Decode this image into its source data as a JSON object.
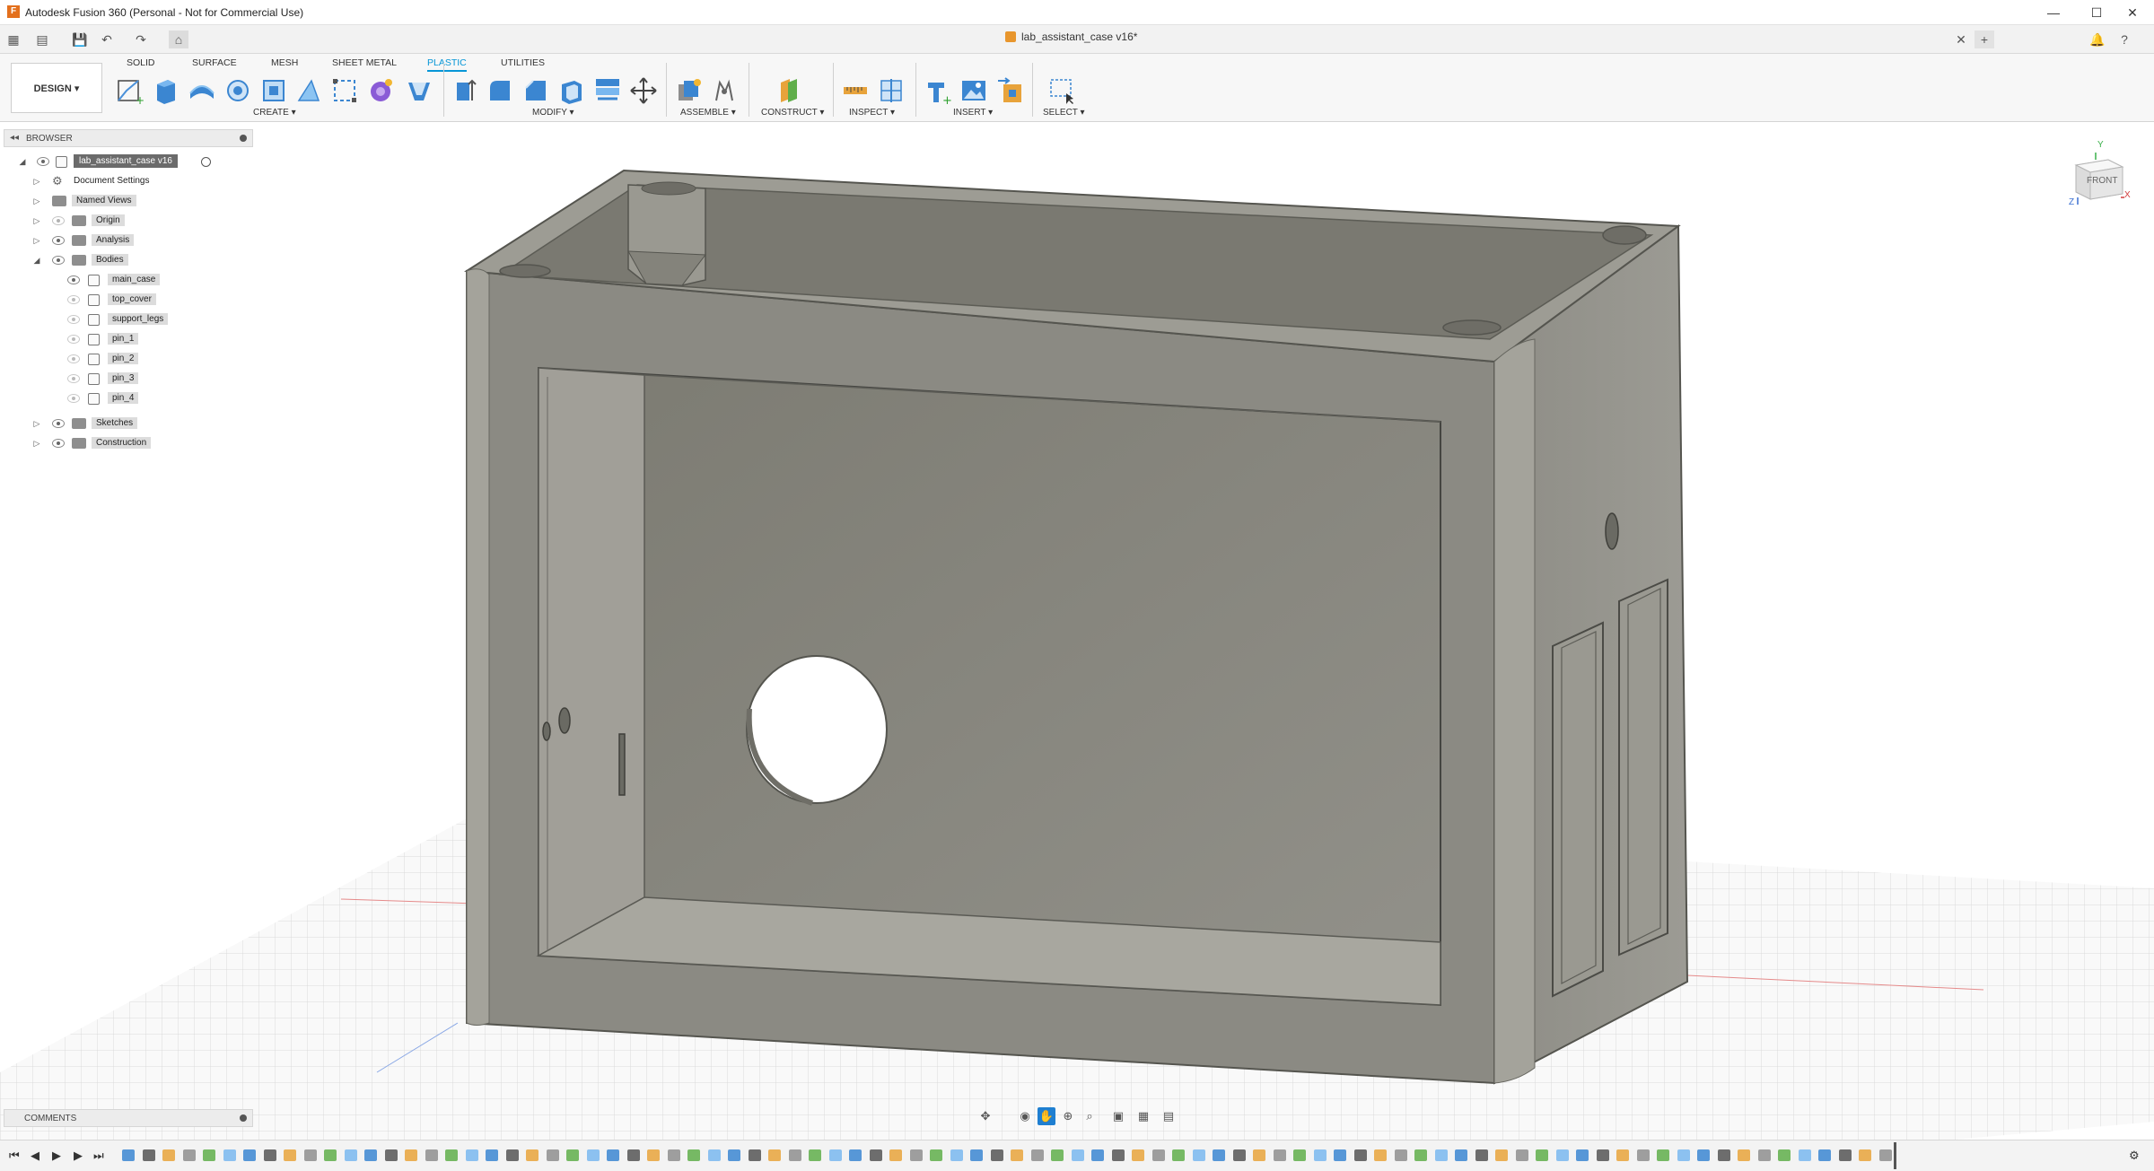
{
  "app": {
    "title": "Autodesk Fusion 360 (Personal - Not for Commercial Use)",
    "logo_letter": "F",
    "document_tab": "lab_assistant_case v16*"
  },
  "window_controls": {
    "minimize": "—",
    "maximize": "☐",
    "close": "✕"
  },
  "quick_access": {
    "grid_icon": "▦",
    "file_icon": "▤",
    "save_icon": "💾",
    "undo_icon": "↶",
    "redo_icon": "↷",
    "home_icon": "⌂",
    "close_tab": "✕",
    "new_tab": "+",
    "notifications_icon": "🔔",
    "help_icon": "?"
  },
  "ribbon": {
    "workspace": "DESIGN ▾",
    "tabs": [
      "SOLID",
      "SURFACE",
      "MESH",
      "SHEET METAL",
      "PLASTIC",
      "UTILITIES"
    ],
    "active_tab": "PLASTIC",
    "groups": [
      "CREATE ▾",
      "MODIFY ▾",
      "ASSEMBLE ▾",
      "CONSTRUCT ▾",
      "INSPECT ▾",
      "INSERT ▾",
      "SELECT ▾"
    ]
  },
  "browser": {
    "title": "BROWSER",
    "root": "lab_assistant_case v16",
    "items": [
      {
        "label": "Document Settings"
      },
      {
        "label": "Named Views"
      },
      {
        "label": "Origin"
      },
      {
        "label": "Analysis"
      },
      {
        "label": "Bodies"
      },
      {
        "label": "main_case"
      },
      {
        "label": "top_cover"
      },
      {
        "label": "support_legs"
      },
      {
        "label": "pin_1"
      },
      {
        "label": "pin_2"
      },
      {
        "label": "pin_3"
      },
      {
        "label": "pin_4"
      },
      {
        "label": "Sketches"
      },
      {
        "label": "Construction"
      }
    ]
  },
  "comments": {
    "title": "COMMENTS"
  },
  "viewcube": {
    "face": "FRONT",
    "axis_x": "X",
    "axis_y": "Y",
    "axis_z": "Z"
  },
  "colors": {
    "accent": "#0696d7",
    "model": "#8c8c83",
    "grid": "#cfcfcf",
    "orange": "#e3701d"
  },
  "navbar": {
    "orbit_icon": "✥",
    "look_icon": "◉",
    "pan_icon": "✋",
    "zoom_icon": "⊕",
    "fit_icon": "⌕",
    "display_icon": "▣",
    "grid_icon": "▦",
    "views_icon": "▤"
  },
  "timeline": {
    "start_icon": "⏮",
    "prev_icon": "◀",
    "play_icon": "▶",
    "next_icon": "▶",
    "end_icon": "⏭",
    "settings_icon": "⚙"
  }
}
